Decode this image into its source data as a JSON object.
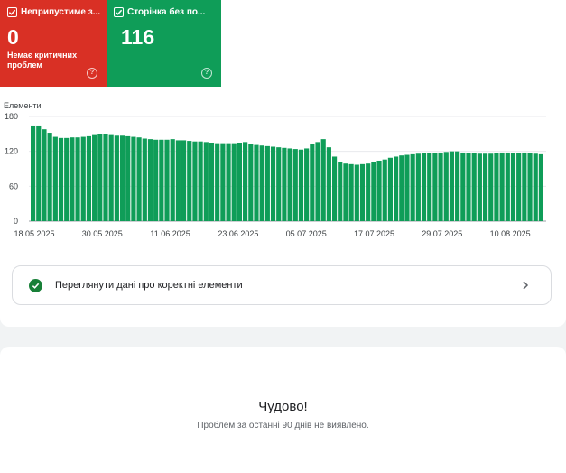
{
  "tiles": [
    {
      "title": "Неприпустиме з...",
      "count": "0",
      "subtitle": "Немає критичних проблем",
      "color": "#d93025"
    },
    {
      "title": "Сторінка без по...",
      "count": "116",
      "color": "#0f9d58"
    }
  ],
  "chart_data": {
    "type": "bar",
    "ylabel": "Елементи",
    "ylim": [
      0,
      180
    ],
    "yticks": [
      0,
      60,
      120,
      180
    ],
    "xtick_labels": [
      "18.05.2025",
      "30.05.2025",
      "11.06.2025",
      "23.06.2025",
      "05.07.2025",
      "17.07.2025",
      "29.07.2025",
      "10.08.2025"
    ],
    "bar_color": "#0f9d58",
    "grid": true,
    "values": [
      163,
      163,
      158,
      152,
      145,
      143,
      143,
      144,
      144,
      145,
      146,
      148,
      149,
      149,
      148,
      147,
      147,
      146,
      145,
      144,
      142,
      141,
      140,
      140,
      140,
      141,
      139,
      139,
      138,
      137,
      137,
      136,
      135,
      134,
      134,
      134,
      134,
      135,
      136,
      133,
      131,
      130,
      129,
      128,
      127,
      126,
      125,
      124,
      123,
      125,
      132,
      136,
      141,
      127,
      111,
      101,
      99,
      98,
      97,
      98,
      99,
      101,
      104,
      106,
      109,
      111,
      113,
      114,
      115,
      116,
      117,
      117,
      117,
      118,
      119,
      120,
      120,
      118,
      117,
      117,
      116,
      116,
      116,
      117,
      118,
      118,
      117,
      117,
      118,
      117,
      116,
      115
    ]
  },
  "correct_items_link": {
    "label": "Переглянути дані про коректні елементи"
  },
  "empty_state": {
    "title": "Чудово!",
    "text": "Проблем за останні 90 днів не виявлено."
  }
}
